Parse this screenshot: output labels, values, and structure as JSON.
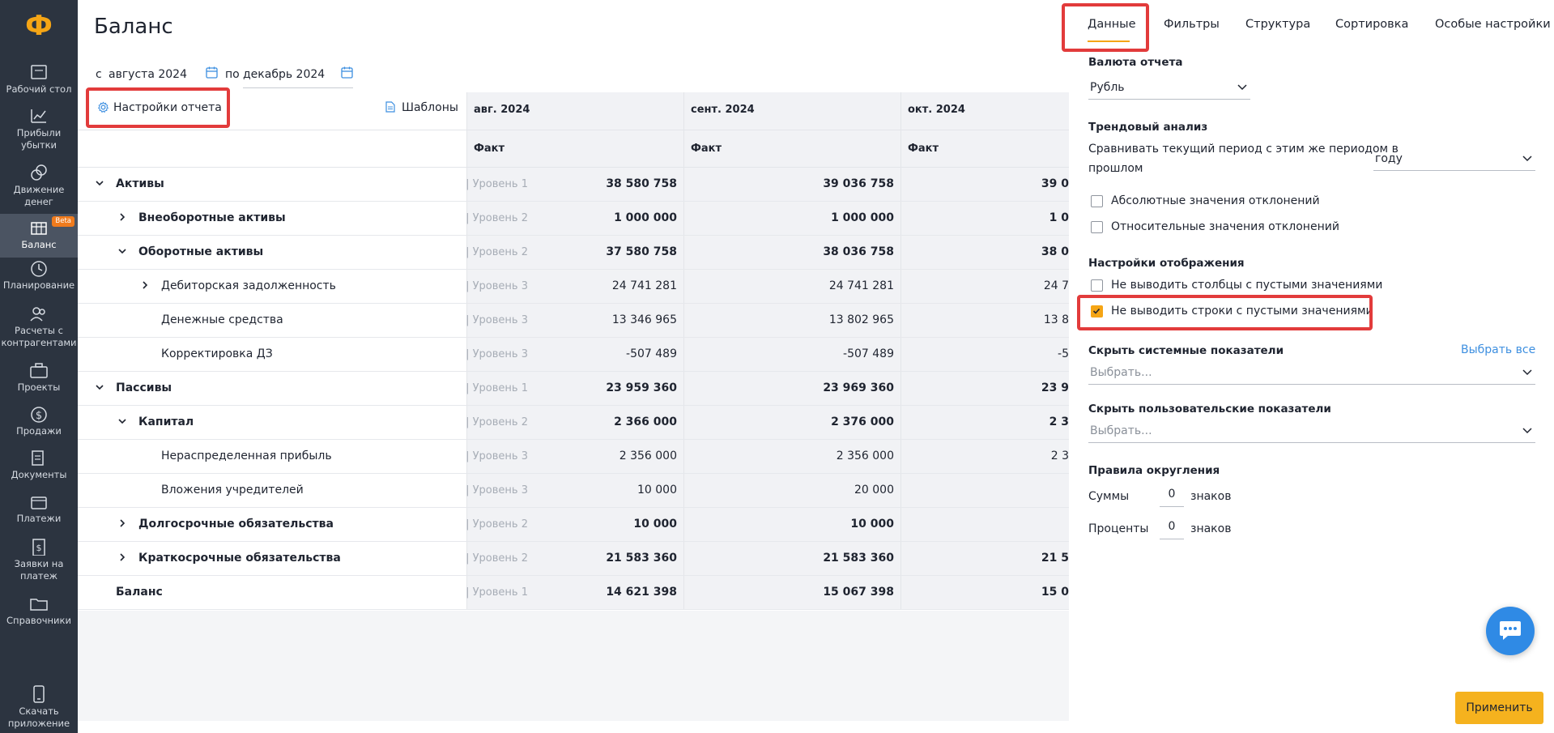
{
  "app": {
    "logo_glyph": "Ф",
    "page_title": "Баланс"
  },
  "sidebar": {
    "items": [
      {
        "label": "Рабочий стол",
        "icon": "desktop-icon"
      },
      {
        "label": "Прибыли убытки",
        "icon": "chart-icon"
      },
      {
        "label": "Движение денег",
        "icon": "coins-icon"
      },
      {
        "label": "Баланс",
        "icon": "balance-icon",
        "badge": "Beta",
        "active": true
      },
      {
        "label": "Планирование",
        "icon": "planning-icon"
      },
      {
        "label": "Расчеты с контрагентами",
        "icon": "users-icon"
      },
      {
        "label": "Проекты",
        "icon": "briefcase-icon"
      },
      {
        "label": "Продажи",
        "icon": "dollar-icon"
      },
      {
        "label": "Документы",
        "icon": "documents-icon"
      },
      {
        "label": "Платежи",
        "icon": "wallet-icon"
      },
      {
        "label": "Заявки на платеж",
        "icon": "request-icon"
      },
      {
        "label": "Справочники",
        "icon": "folder-icon"
      }
    ],
    "download": {
      "label": "Скачать приложение",
      "icon": "phone-icon"
    }
  },
  "period": {
    "from_prefix": "с",
    "from_value": "августа 2024",
    "to_prefix": "по",
    "to_value": "декабрь 2024"
  },
  "toolbar": {
    "settings_label": "Настройки отчета",
    "templates_label": "Шаблоны"
  },
  "table": {
    "columns": [
      {
        "month": "авг. 2024",
        "kind": "Факт"
      },
      {
        "month": "сент. 2024",
        "kind": "Факт"
      },
      {
        "month": "окт. 2024",
        "kind": "Факт"
      }
    ],
    "rows": [
      {
        "name": "Активы",
        "level": "| Уровень 1",
        "values": [
          "38 580 758",
          "39 036 758",
          "39 0"
        ],
        "bold": true,
        "chevron": "down",
        "indent": 0
      },
      {
        "name": "Внеоборотные активы",
        "level": "| Уровень 2",
        "values": [
          "1 000 000",
          "1 000 000",
          "1 0"
        ],
        "bold": true,
        "chevron": "right",
        "indent": 1
      },
      {
        "name": "Оборотные активы",
        "level": "| Уровень 2",
        "values": [
          "37 580 758",
          "38 036 758",
          "38 0"
        ],
        "bold": true,
        "chevron": "down",
        "indent": 1
      },
      {
        "name": "Дебиторская задолженность",
        "level": "| Уровень 3",
        "values": [
          "24 741 281",
          "24 741 281",
          "24 7"
        ],
        "bold": false,
        "chevron": "right",
        "indent": 2
      },
      {
        "name": "Денежные средства",
        "level": "| Уровень 3",
        "values": [
          "13 346 965",
          "13 802 965",
          "13 8"
        ],
        "bold": false,
        "chevron": "none",
        "indent": 2
      },
      {
        "name": "Корректировка ДЗ",
        "level": "| Уровень 3",
        "values": [
          "-507 489",
          "-507 489",
          "-5"
        ],
        "bold": false,
        "chevron": "none",
        "indent": 2
      },
      {
        "name": "Пассивы",
        "level": "| Уровень 1",
        "values": [
          "23 959 360",
          "23 969 360",
          "23 9"
        ],
        "bold": true,
        "chevron": "down",
        "indent": 0
      },
      {
        "name": "Капитал",
        "level": "| Уровень 2",
        "values": [
          "2 366 000",
          "2 376 000",
          "2 3"
        ],
        "bold": true,
        "chevron": "down",
        "indent": 1
      },
      {
        "name": "Нераспределенная прибыль",
        "level": "| Уровень 3",
        "values": [
          "2 356 000",
          "2 356 000",
          "2 3"
        ],
        "bold": false,
        "chevron": "none",
        "indent": 2
      },
      {
        "name": "Вложения учредителей",
        "level": "| Уровень 3",
        "values": [
          "10 000",
          "20 000",
          ""
        ],
        "bold": false,
        "chevron": "none",
        "indent": 2
      },
      {
        "name": "Долгосрочные обязательства",
        "level": "| Уровень 2",
        "values": [
          "10 000",
          "10 000",
          ""
        ],
        "bold": true,
        "chevron": "right",
        "indent": 1
      },
      {
        "name": "Краткосрочные обязательства",
        "level": "| Уровень 2",
        "values": [
          "21 583 360",
          "21 583 360",
          "21 5"
        ],
        "bold": true,
        "chevron": "right",
        "indent": 1
      },
      {
        "name": "Баланс",
        "level": "| Уровень 1",
        "values": [
          "14 621 398",
          "15 067 398",
          "15 0"
        ],
        "bold": true,
        "chevron": "none",
        "indent": 0
      }
    ]
  },
  "panel": {
    "tabs": [
      "Данные",
      "Фильтры",
      "Структура",
      "Сортировка",
      "Особые настройки"
    ],
    "active_tab": "Данные",
    "currency": {
      "label": "Валюта отчета",
      "value": "Рубль"
    },
    "trend": {
      "label": "Трендовый анализ",
      "compare_text_1": "Сравнивать текущий период с этим же периодом в",
      "compare_text_2": "прошлом",
      "compare_value": "году",
      "abs_label": "Абсолютные значения отклонений",
      "rel_label": "Относительные значения отклонений"
    },
    "display": {
      "label": "Настройки отображения",
      "hide_cols_label": "Не выводить столбцы с пустыми значениями",
      "hide_rows_label": "Не выводить строки с пустыми значениями",
      "hide_rows_checked": true
    },
    "system_metrics": {
      "label": "Скрыть системные показатели",
      "select_all": "Выбрать все",
      "placeholder": "Выбрать..."
    },
    "user_metrics": {
      "label": "Скрыть пользовательские показатели",
      "placeholder": "Выбрать..."
    },
    "rounding": {
      "label": "Правила округления",
      "sums_label": "Суммы",
      "sums_value": "0",
      "percent_label": "Проценты",
      "percent_value": "0",
      "unit": "знаков"
    },
    "apply_label": "Применить"
  },
  "colors": {
    "accent": "#f5a515",
    "highlight": "#e23b3b",
    "link": "#3d8fe0",
    "sidebar": "#2c3440"
  }
}
